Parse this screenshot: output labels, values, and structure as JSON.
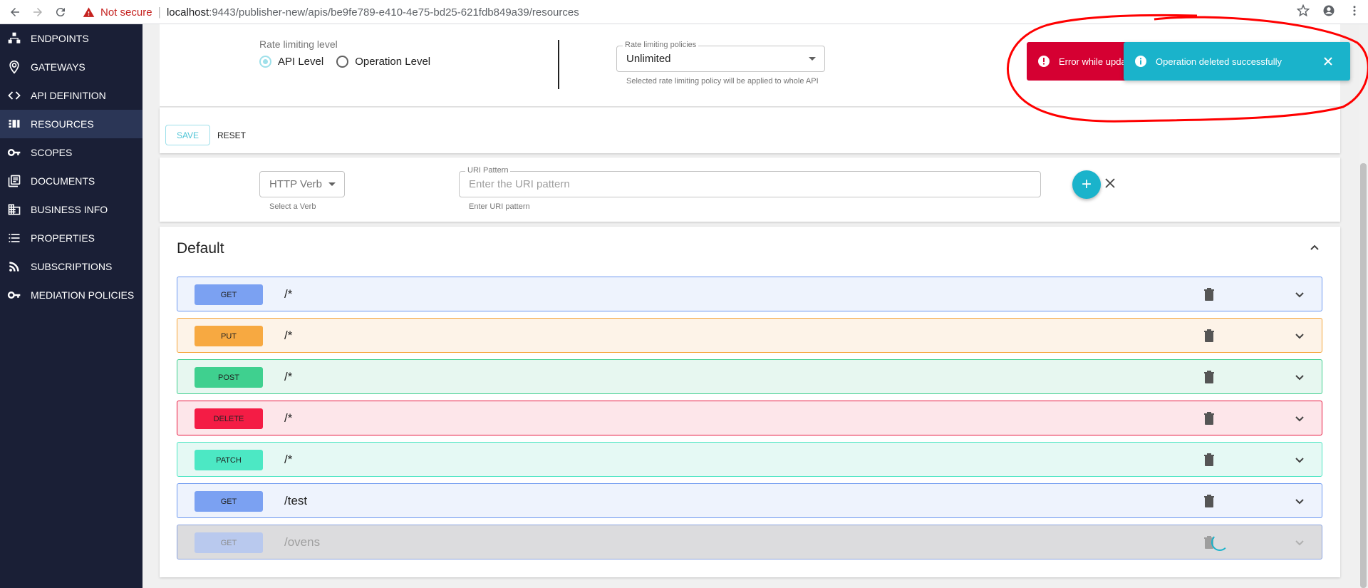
{
  "browser": {
    "not_secure": "Not secure",
    "url_host": "localhost",
    "url_path": ":9443/publisher-new/apis/be9fe789-e410-4e75-bd25-621fdb849a39/resources"
  },
  "sidebar": {
    "items": [
      {
        "label": "ENDPOINTS",
        "icon": "endpoints-icon"
      },
      {
        "label": "GATEWAYS",
        "icon": "location-pin-icon"
      },
      {
        "label": "API DEFINITION",
        "icon": "code-icon"
      },
      {
        "label": "RESOURCES",
        "icon": "resources-icon",
        "active": true
      },
      {
        "label": "SCOPES",
        "icon": "key-icon"
      },
      {
        "label": "DOCUMENTS",
        "icon": "documents-icon"
      },
      {
        "label": "BUSINESS INFO",
        "icon": "business-icon"
      },
      {
        "label": "PROPERTIES",
        "icon": "list-icon"
      },
      {
        "label": "SUBSCRIPTIONS",
        "icon": "rss-icon"
      },
      {
        "label": "MEDIATION POLICIES",
        "icon": "key-icon"
      }
    ]
  },
  "rate_limiting": {
    "title": "Rate limiting level",
    "options": [
      "API Level",
      "Operation Level"
    ],
    "selected": "API Level",
    "policies_label": "Rate limiting policies",
    "policy_value": "Unlimited",
    "policy_helper": "Selected rate limiting policy will be applied to whole API"
  },
  "actions": {
    "save": "SAVE",
    "reset": "RESET"
  },
  "new_operation": {
    "verb_placeholder": "HTTP Verb",
    "verb_helper": "Select a Verb",
    "uri_label": "URI Pattern",
    "uri_placeholder": "Enter the URI pattern",
    "uri_helper": "Enter URI pattern"
  },
  "group": {
    "title": "Default"
  },
  "operations": [
    {
      "verb": "GET",
      "path": "/*"
    },
    {
      "verb": "PUT",
      "path": "/*"
    },
    {
      "verb": "POST",
      "path": "/*"
    },
    {
      "verb": "DELETE",
      "path": "/*"
    },
    {
      "verb": "PATCH",
      "path": "/*"
    },
    {
      "verb": "GET",
      "path": "/test"
    },
    {
      "verb": "GET",
      "path": "/ovens",
      "pending": true
    }
  ],
  "toasts": {
    "error": "Error while updating",
    "info": "Operation deleted successfully"
  },
  "colors": {
    "sidebar_bg": "#1a1f36",
    "accent": "#1ab3cb",
    "error": "#d50032",
    "annotation": "#ff0000"
  }
}
